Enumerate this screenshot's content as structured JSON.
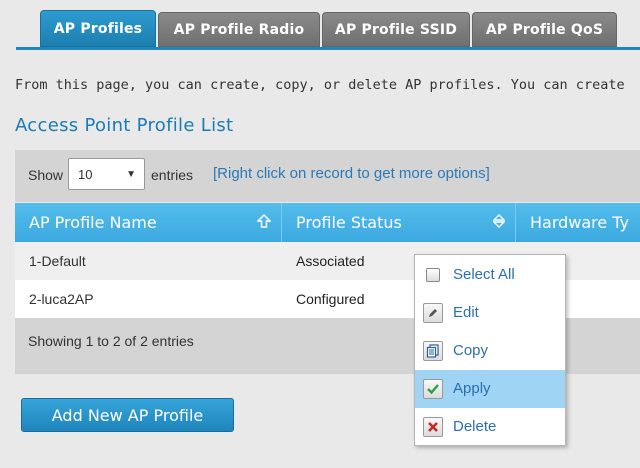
{
  "tabs": [
    {
      "label": "AP Profiles",
      "active": true
    },
    {
      "label": "AP Profile Radio",
      "active": false
    },
    {
      "label": "AP Profile SSID",
      "active": false
    },
    {
      "label": "AP Profile QoS",
      "active": false
    }
  ],
  "description": "From this page, you can create, copy, or delete AP profiles. You can create",
  "section_title": "Access Point Profile List",
  "table_controls": {
    "show_label": "Show",
    "entries_value": "10",
    "entries_label": "entries",
    "hint": "[Right click on record to get more options]"
  },
  "table": {
    "columns": [
      "AP Profile Name",
      "Profile Status",
      "Hardware Ty"
    ],
    "rows": [
      {
        "name": "1-Default",
        "status": "Associated"
      },
      {
        "name": "2-luca2AP",
        "status": "Configured"
      }
    ],
    "footer": "Showing 1 to 2 of 2 entries"
  },
  "add_button_label": "Add New AP Profile",
  "context_menu": {
    "items": [
      {
        "label": "Select All",
        "icon": "checkbox-icon",
        "highlighted": false
      },
      {
        "label": "Edit",
        "icon": "pencil-icon",
        "highlighted": false
      },
      {
        "label": "Copy",
        "icon": "copy-icon",
        "highlighted": false
      },
      {
        "label": "Apply",
        "icon": "checkmark-icon",
        "highlighted": true
      },
      {
        "label": "Delete",
        "icon": "delete-x-icon",
        "highlighted": false
      }
    ]
  },
  "colors": {
    "accent": "#1f86b8",
    "header": "#3ba8df",
    "highlight": "#9fd4f5",
    "link": "#2b6fb0"
  }
}
